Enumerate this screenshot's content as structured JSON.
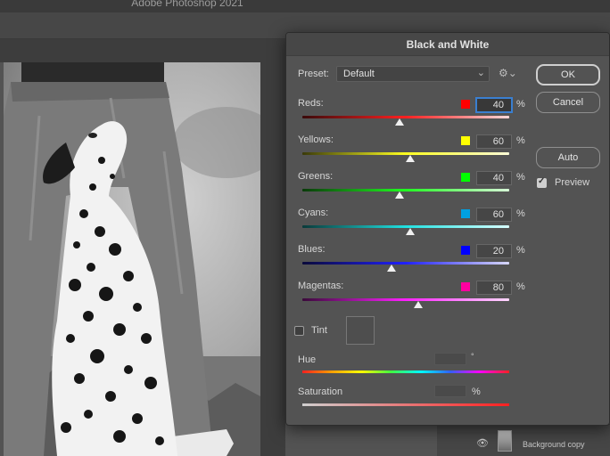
{
  "app": {
    "window_title": "Adobe Photoshop 2021"
  },
  "dialog": {
    "title": "Black and White",
    "preset_label": "Preset:",
    "preset_value": "Default",
    "buttons": {
      "ok": "OK",
      "cancel": "Cancel",
      "auto": "Auto"
    },
    "preview": {
      "label": "Preview",
      "checked": true
    },
    "sliders": [
      {
        "label": "Reds:",
        "value": "40",
        "unit": "%",
        "swatch": "#ff0000",
        "level": 0.47,
        "gradient": [
          "#3a0a0a",
          "#ff2020",
          "#ffd8d8"
        ]
      },
      {
        "label": "Yellows:",
        "value": "60",
        "unit": "%",
        "swatch": "#ffff00",
        "level": 0.52,
        "gradient": [
          "#3a3a0a",
          "#ffff20",
          "#ffffd8"
        ]
      },
      {
        "label": "Greens:",
        "value": "40",
        "unit": "%",
        "swatch": "#00ff00",
        "level": 0.47,
        "gradient": [
          "#0a3a0a",
          "#20ff20",
          "#d8ffd8"
        ]
      },
      {
        "label": "Cyans:",
        "value": "60",
        "unit": "%",
        "swatch": "#00a0e0",
        "level": 0.52,
        "gradient": [
          "#0a3a3a",
          "#20e0e0",
          "#d8ffff"
        ]
      },
      {
        "label": "Blues:",
        "value": "20",
        "unit": "%",
        "swatch": "#0000ff",
        "level": 0.43,
        "gradient": [
          "#0a0a3a",
          "#2020ff",
          "#d8d8ff"
        ]
      },
      {
        "label": "Magentas:",
        "value": "80",
        "unit": "%",
        "swatch": "#ff00a0",
        "level": 0.56,
        "gradient": [
          "#3a0a3a",
          "#ff20ff",
          "#ffd8ff"
        ]
      }
    ],
    "tint": {
      "label": "Tint",
      "checked": false
    },
    "hue": {
      "label": "Hue",
      "unit": "°"
    },
    "saturation": {
      "label": "Saturation",
      "unit": "%"
    }
  },
  "layers_panel": {
    "layer_name": "Background copy"
  },
  "colors": {
    "dialog_bg": "#535353",
    "focus_ring": "#3a7fd0"
  }
}
